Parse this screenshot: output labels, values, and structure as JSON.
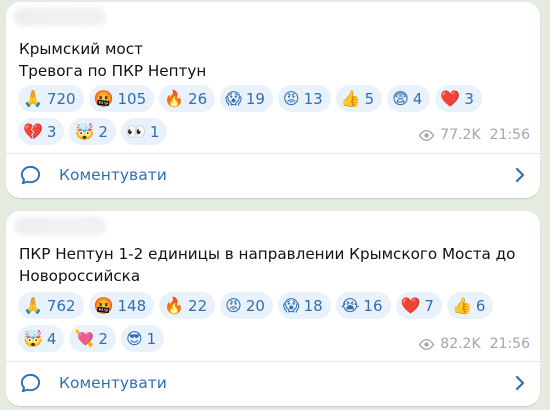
{
  "posts": [
    {
      "text": "Крымский мост\nТревога по ПКР Нептун",
      "reactions": [
        [
          {
            "emoji": "🙏",
            "count": "720"
          },
          {
            "emoji": "🤬",
            "count": "105"
          },
          {
            "emoji": "🔥",
            "count": "26"
          },
          {
            "emoji": "😱",
            "count": "19"
          },
          {
            "emoji": "😡",
            "count": "13"
          },
          {
            "emoji": "👍",
            "count": "5"
          },
          {
            "emoji": "😨",
            "count": "4"
          },
          {
            "emoji": "❤️",
            "count": "3"
          }
        ],
        [
          {
            "emoji": "💔",
            "count": "3"
          },
          {
            "emoji": "🤯",
            "count": "2"
          },
          {
            "emoji": "👀",
            "count": "1"
          }
        ]
      ],
      "views": "77.2K",
      "time": "21:56",
      "comment_label": "Коментувати"
    },
    {
      "text": "ПКР Нептун 1-2 единицы в направлении Крымского Моста до\nНовороссийска",
      "reactions": [
        [
          {
            "emoji": "🙏",
            "count": "762"
          },
          {
            "emoji": "🤬",
            "count": "148"
          },
          {
            "emoji": "🔥",
            "count": "22"
          },
          {
            "emoji": "😡",
            "count": "20"
          },
          {
            "emoji": "😱",
            "count": "18"
          },
          {
            "emoji": "😭",
            "count": "16"
          },
          {
            "emoji": "❤️",
            "count": "7"
          },
          {
            "emoji": "👍",
            "count": "6"
          }
        ],
        [
          {
            "emoji": "🤯",
            "count": "4"
          },
          {
            "emoji": "💘",
            "count": "2"
          },
          {
            "emoji": "😎",
            "count": "1"
          }
        ]
      ],
      "views": "82.2K",
      "time": "21:56",
      "comment_label": "Коментувати"
    }
  ],
  "colors": {
    "accent": "#2f6fb2",
    "chip_bg": "#e9f1fb",
    "meta": "#a0a7ad",
    "background": "#e4ebdf"
  }
}
